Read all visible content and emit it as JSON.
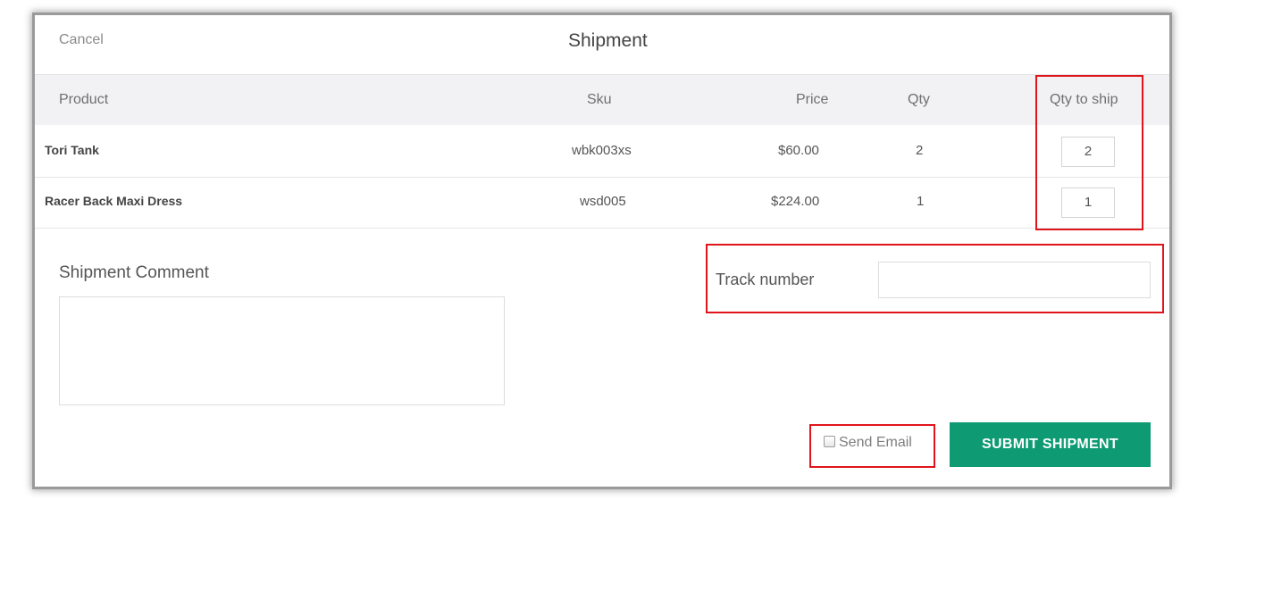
{
  "modal": {
    "cancel_label": "Cancel",
    "title": "Shipment"
  },
  "table": {
    "columns": [
      "Product",
      "Sku",
      "Price",
      "Qty",
      "Qty to ship"
    ],
    "rows": [
      {
        "product": "Tori Tank",
        "sku": "wbk003xs",
        "price": "$60.00",
        "qty": "2",
        "qty_to_ship": "2"
      },
      {
        "product": "Racer Back Maxi Dress",
        "sku": "wsd005",
        "price": "$224.00",
        "qty": "1",
        "qty_to_ship": "1"
      }
    ]
  },
  "comment": {
    "label": "Shipment Comment",
    "value": ""
  },
  "tracking": {
    "label": "Track number",
    "value": ""
  },
  "footer": {
    "send_email_label": "Send Email",
    "send_email_checked": false,
    "submit_label": "SUBMIT SHIPMENT"
  },
  "colors": {
    "accent": "#0e9b73",
    "highlight": "#e0141b",
    "header_bg": "#f2f2f4"
  }
}
